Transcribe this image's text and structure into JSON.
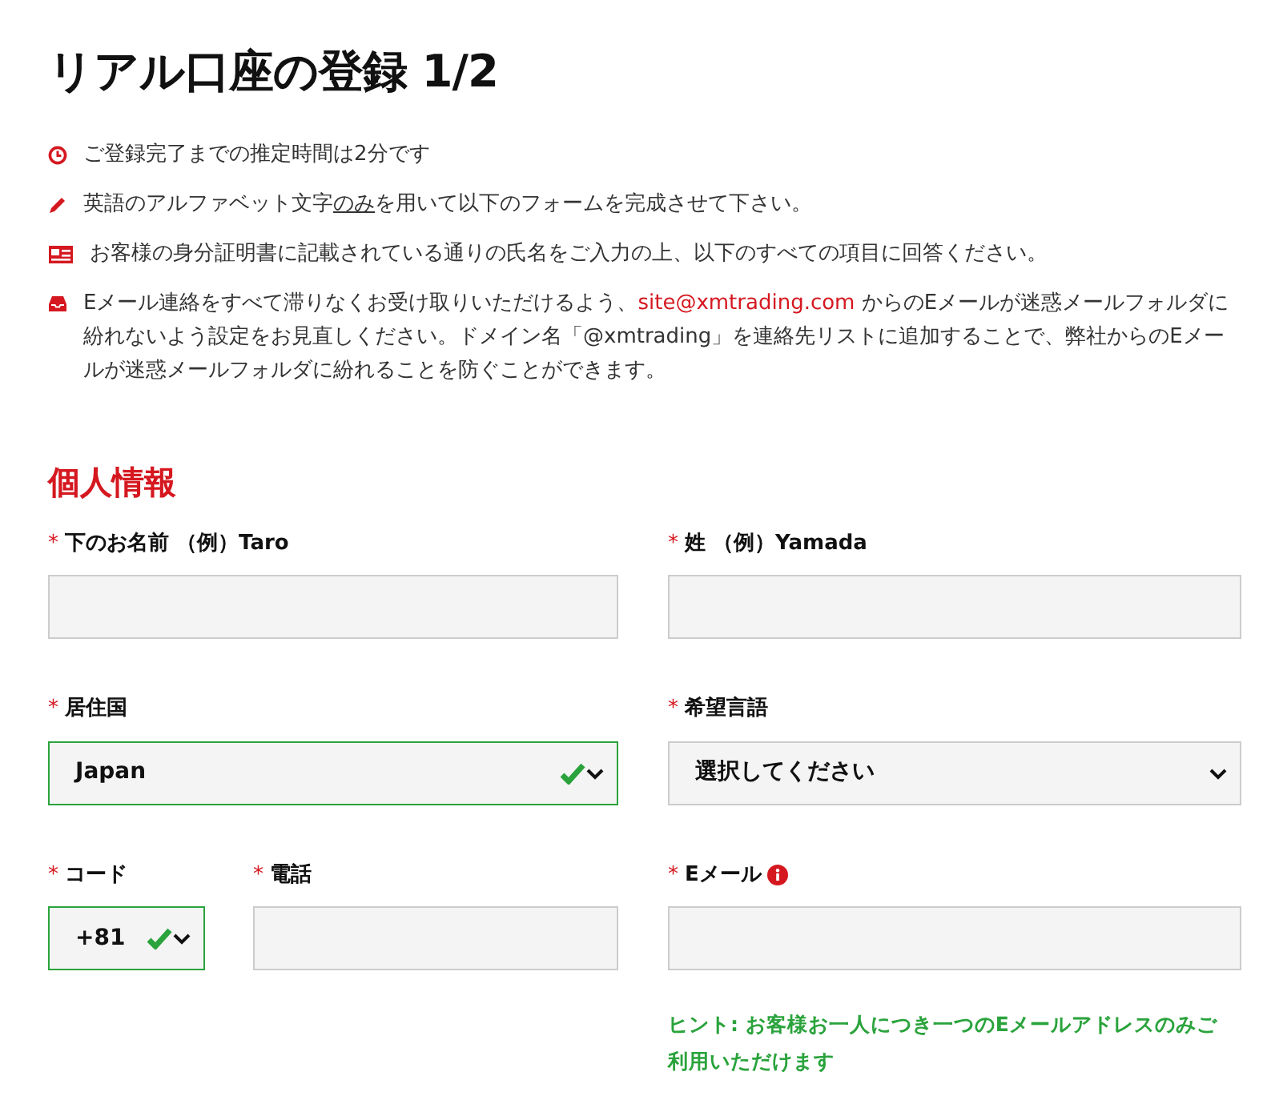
{
  "title": "リアル口座の登録 1/2",
  "notes": [
    {
      "kind": "clock",
      "parts": [
        {
          "kind": "text",
          "text": "ご登録完了までの推定時間は2分です"
        }
      ]
    },
    {
      "kind": "pencil",
      "parts": [
        {
          "kind": "text",
          "text": "英語のアルファベット文字"
        },
        {
          "kind": "underline",
          "text": "のみ"
        },
        {
          "kind": "text",
          "text": "を用いて以下のフォームを完成させて下さい。"
        }
      ]
    },
    {
      "kind": "idcard",
      "parts": [
        {
          "kind": "text",
          "text": "お客様の身分証明書に記載されている通りの氏名をご入力の上、以下のすべての項目に回答ください。"
        }
      ]
    },
    {
      "kind": "inbox",
      "parts": [
        {
          "kind": "text",
          "text": "Eメール連絡をすべて滞りなくお受け取りいただけるよう、"
        },
        {
          "kind": "link",
          "text": "site@xmtrading.com"
        },
        {
          "kind": "text",
          "text": " からのEメールが迷惑メールフォルダに紛れないよう設定をお見直しください。ドメイン名「@xmtrading」を連絡先リストに追加することで、弊社からのEメールが迷惑メールフォルダに紛れることを防ぐことができます。"
        }
      ]
    }
  ],
  "section": "個人情報",
  "rows": [
    [
      {
        "kind": "text",
        "required_mark": "*",
        "label": "下のお名前 （例）Taro",
        "valid": false
      },
      {
        "kind": "text",
        "required_mark": "*",
        "label": "姓 （例）Yamada",
        "valid": false
      }
    ],
    [
      {
        "kind": "select",
        "required_mark": "*",
        "label": "居住国",
        "value": "Japan",
        "valid": true
      },
      {
        "kind": "select",
        "required_mark": "*",
        "label": "希望言語",
        "value": "選択してください",
        "valid": false
      }
    ],
    [
      {
        "kind": "pair",
        "fields": [
          {
            "kind": "select",
            "required_mark": "*",
            "label": "コード",
            "value": "+81",
            "valid": true
          },
          {
            "kind": "text",
            "required_mark": "*",
            "label": "電話",
            "valid": false
          }
        ]
      },
      {
        "kind": "text",
        "required_mark": "*",
        "label": "Eメール",
        "valid": false,
        "info": true,
        "hint": "ヒント: お客様お一人につき一つのEメールアドレスのみご利用いただけます"
      }
    ]
  ]
}
